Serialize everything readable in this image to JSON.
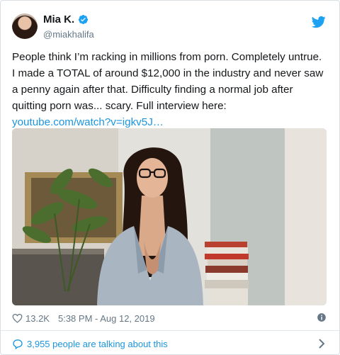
{
  "tweet": {
    "author_name": "Mia K.",
    "author_handle": "@miakhalifa",
    "text_before_link": "People think I’m racking in millions from porn. Completely untrue. I made a TOTAL of around $12,000 in the industry and never saw a penny again after that. Difficulty finding a normal job after quitting porn was... scary. Full interview here: ",
    "link_text": "youtube.com/watch?v=igkv5J…",
    "like_count": "13.2K",
    "timestamp": "5:38 PM - Aug 12, 2019",
    "talking_text": "3,955 people are talking about this"
  },
  "colors": {
    "accent": "#1b95e0",
    "muted": "#657786",
    "verified": "#1da1f2"
  },
  "icons": {
    "verified": "verified-badge-icon",
    "brand": "twitter-bird-icon",
    "like": "heart-icon",
    "info": "info-icon",
    "reply": "speech-bubble-icon",
    "more": "chevron-right-icon"
  }
}
